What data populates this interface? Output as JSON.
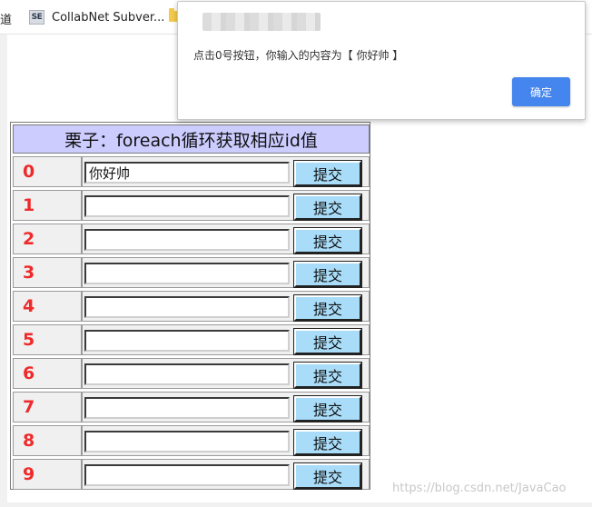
{
  "bookmarks": {
    "partial_label": "道",
    "items": [
      {
        "icon": "se-icon",
        "icon_text": "SE",
        "label": "CollabNet Subver..."
      }
    ]
  },
  "table": {
    "title": "栗子：foreach循环获取相应id值",
    "button_label": "提交",
    "rows": [
      {
        "num": "0",
        "value": "你好帅"
      },
      {
        "num": "1",
        "value": ""
      },
      {
        "num": "2",
        "value": ""
      },
      {
        "num": "3",
        "value": ""
      },
      {
        "num": "4",
        "value": ""
      },
      {
        "num": "5",
        "value": ""
      },
      {
        "num": "6",
        "value": ""
      },
      {
        "num": "7",
        "value": ""
      },
      {
        "num": "8",
        "value": ""
      },
      {
        "num": "9",
        "value": ""
      }
    ]
  },
  "alert": {
    "message": "点击0号按钮，你输入的内容为【  你好帅 】",
    "ok_label": "确定"
  },
  "watermark": "https://blog.csdn.net/JavaCao",
  "colors": {
    "title_bg": "#ccccff",
    "row_number": "#ee2a2a",
    "submit_button": "#a8dcf8",
    "ok_button": "#4585ee"
  }
}
